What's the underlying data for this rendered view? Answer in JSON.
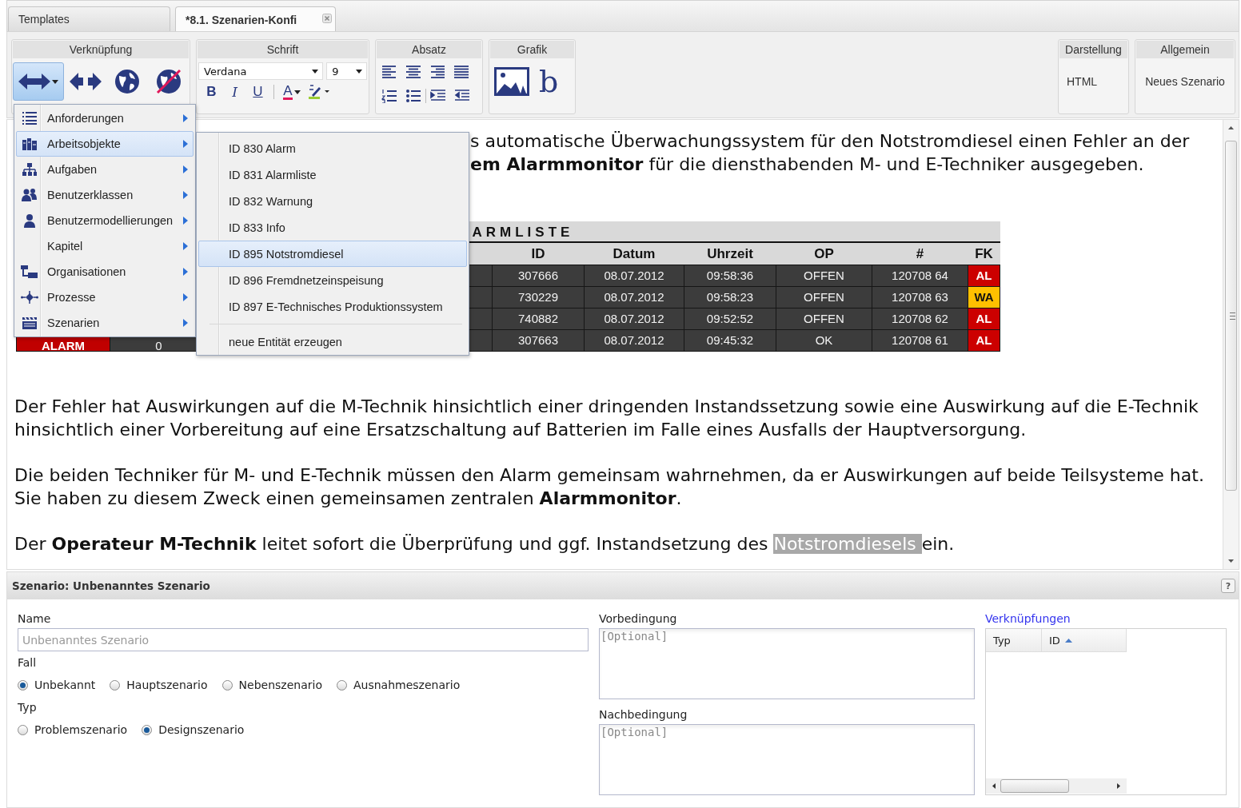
{
  "tabs": [
    {
      "label": "Templates",
      "selected": false,
      "closable": false
    },
    {
      "label": "*8.1. Szenarien-Konfi",
      "selected": true,
      "closable": true
    }
  ],
  "ribbon": {
    "link_group": {
      "title": "Verknüpfung",
      "buttons": [
        {
          "kind": "link",
          "selected": true,
          "has_dropdown": true
        },
        {
          "kind": "split",
          "selected": false,
          "has_dropdown": false
        },
        {
          "kind": "globe",
          "selected": false,
          "has_dropdown": false
        },
        {
          "kind": "globe-off",
          "selected": false,
          "has_dropdown": false
        }
      ]
    },
    "font_group": {
      "title": "Schrift",
      "font": "Verdana",
      "size": "9",
      "buttons": [
        {
          "kind": "bold",
          "label": "B"
        },
        {
          "kind": "italic",
          "label": "I"
        },
        {
          "kind": "underline",
          "label": "U"
        },
        {
          "kind": "font-color",
          "label": "A"
        },
        {
          "kind": "highlight"
        }
      ]
    },
    "paragraph_group": {
      "title": "Absatz",
      "buttons": [
        {
          "kind": "align-left"
        },
        {
          "kind": "align-center"
        },
        {
          "kind": "align-right"
        },
        {
          "kind": "justify"
        },
        {
          "kind": "numbered-list"
        },
        {
          "kind": "bullet-list"
        },
        {
          "kind": "indent"
        },
        {
          "kind": "outdent"
        }
      ]
    },
    "graphic_group": {
      "title": "Grafik",
      "buttons": [
        {
          "kind": "image"
        },
        {
          "kind": "text",
          "label": "b"
        }
      ]
    },
    "view_group": {
      "title": "Darstellung",
      "value": "HTML"
    },
    "general_group": {
      "title": "Allgemein",
      "value": "Neues Szenario"
    }
  },
  "menu": {
    "items": [
      {
        "label": "Anforderungen",
        "kind": "list",
        "selected": false
      },
      {
        "label": "Arbeitsobjekte",
        "kind": "objects",
        "selected": true
      },
      {
        "label": "Aufgaben",
        "kind": "tasks",
        "selected": false
      },
      {
        "label": "Benutzerklassen",
        "kind": "group",
        "selected": false
      },
      {
        "label": "Benutzermodellierungen",
        "kind": "user",
        "selected": false
      },
      {
        "label": "Kapitel",
        "kind": "chapter",
        "selected": false
      },
      {
        "label": "Organisationen",
        "kind": "org",
        "selected": false
      },
      {
        "label": "Prozesse",
        "kind": "process",
        "selected": false
      },
      {
        "label": "Szenarien",
        "kind": "scenario",
        "selected": false
      }
    ],
    "submenu": {
      "items": [
        {
          "label": "ID 830 Alarm",
          "selected": false
        },
        {
          "label": "ID 831 Alarmliste",
          "selected": false
        },
        {
          "label": "ID 832 Warnung",
          "selected": false
        },
        {
          "label": "ID 833 Info",
          "selected": false
        },
        {
          "label": "ID 895 Notstromdiesel",
          "selected": true
        },
        {
          "label": "ID 896 Fremdnetzeinspeisung",
          "selected": false
        },
        {
          "label": "ID 897 E-Technisches Produktionssystem",
          "selected": false
        }
      ],
      "action": "neue Entität erzeugen"
    }
  },
  "document": {
    "top_lines": [
      "s automatische Überwachungssystem für den Notstromdiesel einen Fehler an der",
      "**em Alarmmonitor** für die diensthabenden M- und E-Techniker ausgegeben."
    ],
    "table": {
      "title": "ARMLISTE",
      "columns": [
        "ID",
        "Datum",
        "Uhrzeit",
        "OP",
        "#",
        "FK"
      ],
      "rows": [
        {
          "cells": [
            "307666",
            "08.07.2012",
            "09:58:36",
            "OFFEN",
            "120708 64"
          ],
          "fk": "AL",
          "color": "#cc0000"
        },
        {
          "cells": [
            "730229",
            "08.07.2012",
            "09:58:23",
            "OFFEN",
            "120708 63"
          ],
          "fk": "WA",
          "color": "#ffc000"
        },
        {
          "cells": [
            "740882",
            "08.07.2012",
            "09:52:52",
            "OFFEN",
            "120708 62"
          ],
          "fk": "AL",
          "color": "#cc0000"
        },
        {
          "lead": [
            "ALARM",
            "0"
          ],
          "cells": [
            "307663",
            "08.07.2012",
            "09:45:32",
            "OK",
            "120708 61"
          ],
          "fk": "AL",
          "color": "#cc0000"
        }
      ]
    },
    "paragraphs": [
      [
        {
          "text": "Der Fehler hat Auswirkungen auf die M-Technik hinsichtlich einer dringenden Instandssetzung sowie eine Auswirkung auf die E-Technik hinsichtlich einer Vorbereitung auf eine Ersatzschaltung auf Batterien im Falle eines Ausfalls der Hauptversorgung.",
          "highlighted": false
        }
      ],
      [
        {
          "text": "Die beiden Techniker für M- und E-Technik müssen den Alarm gemeinsam wahrnehmen, da er Auswirkungen auf beide Teilsysteme hat. Sie haben zu diesem Zweck einen gemeinsamen zentralen **Alarmmonitor**.",
          "highlighted": false
        }
      ],
      [
        {
          "text": "Der **Operateur M-Technik** leitet sofort die Überprüfung und ggf. Instandsetzung des ",
          "highlighted": false
        },
        {
          "text": "Notstromdiesels ",
          "highlighted": true
        },
        {
          "text": "ein.",
          "highlighted": false
        }
      ]
    ]
  },
  "scenario": {
    "title": "Szenario: Unbenanntes Szenario",
    "help": "?",
    "name": {
      "label": "Name",
      "placeholder": "Unbenanntes Szenario"
    },
    "case": {
      "label": "Fall",
      "options": [
        {
          "label": "Unbekannt",
          "selected": true
        },
        {
          "label": "Hauptszenario",
          "selected": false
        },
        {
          "label": "Nebenszenario",
          "selected": false
        },
        {
          "label": "Ausnahmeszenario",
          "selected": false
        }
      ]
    },
    "type": {
      "label": "Typ",
      "options": [
        {
          "label": "Problemszenario",
          "selected": false
        },
        {
          "label": "Designszenario",
          "selected": true
        }
      ]
    },
    "precondition": {
      "label": "Vorbedingung",
      "placeholder": "[Optional]"
    },
    "postcondition": {
      "label": "Nachbedingung",
      "placeholder": "[Optional]"
    },
    "links": {
      "label": "Verknüpfungen",
      "columns": [
        {
          "label": "Typ",
          "sorted": false
        },
        {
          "label": "ID",
          "sorted": true
        }
      ]
    }
  }
}
